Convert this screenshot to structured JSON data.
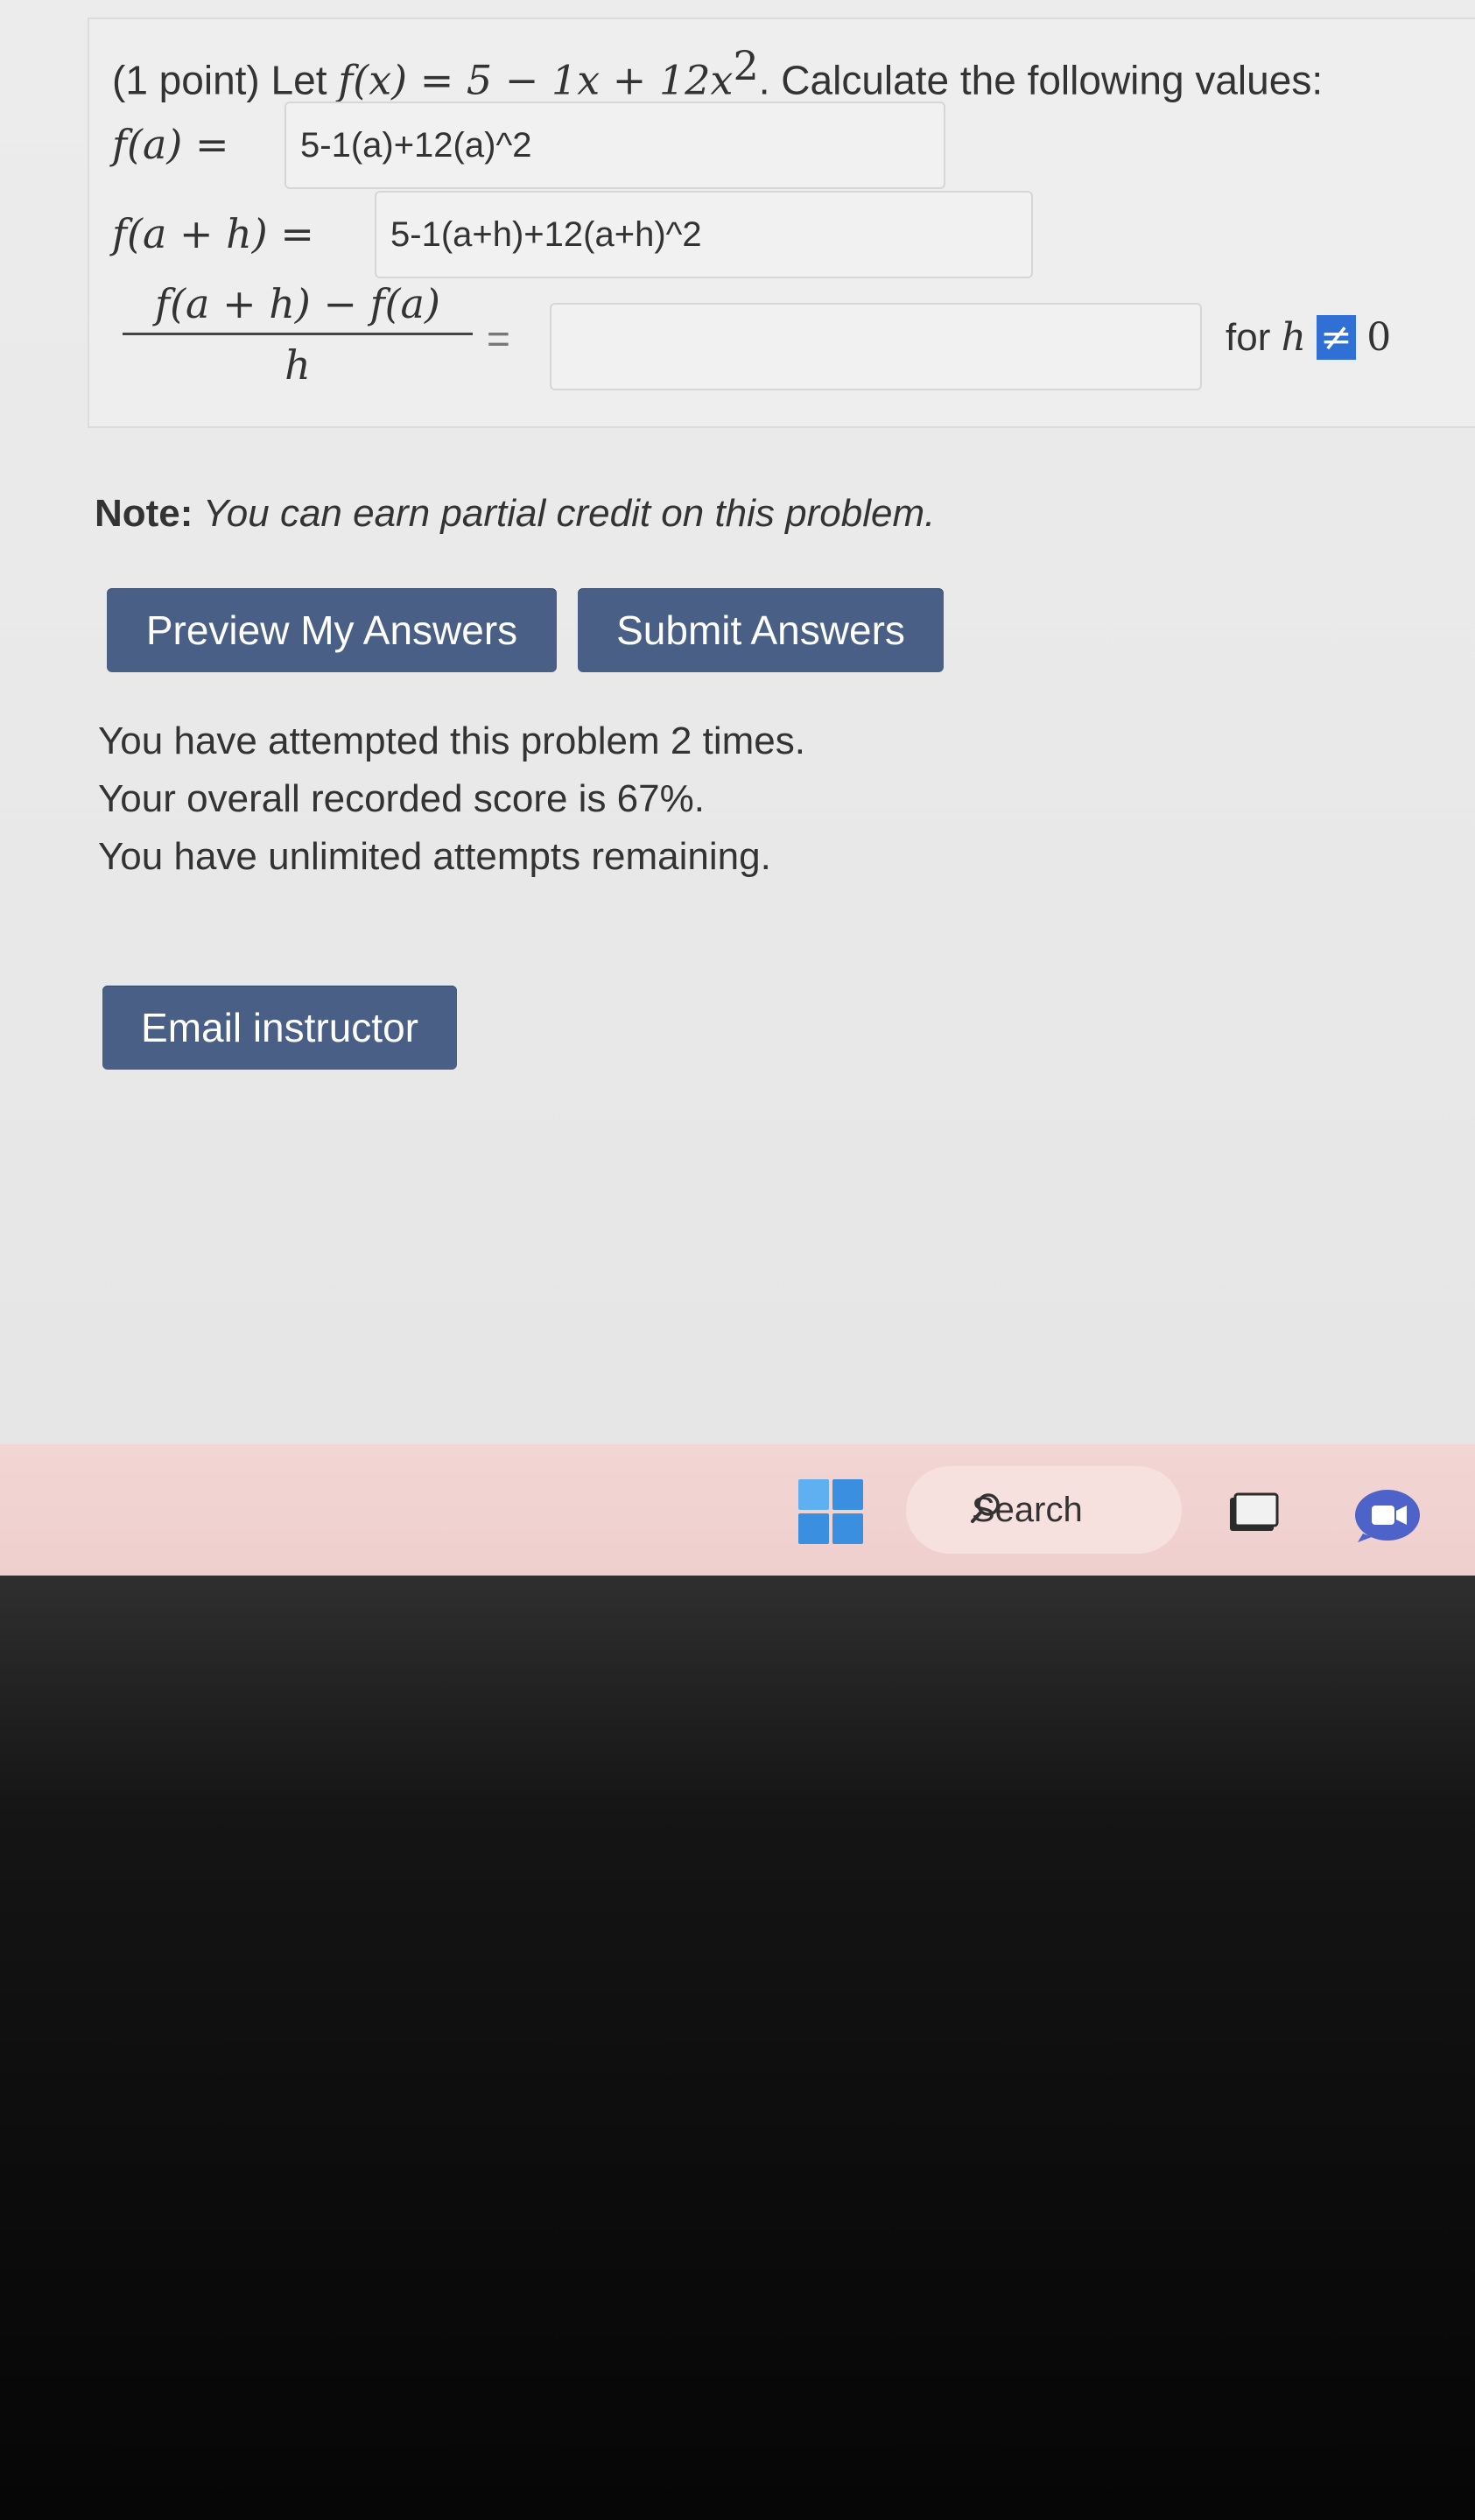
{
  "problem": {
    "intro_prefix": "(1 point) Let ",
    "function_def": "f(x) = 5 − 1x + 12x",
    "function_exp": "2",
    "intro_suffix": ". Calculate the following values:",
    "row1": {
      "label": "f(a) =",
      "value": "5-1(a)+12(a)^2"
    },
    "row2": {
      "label": "f(a + h) =",
      "value": "5-1(a+h)+12(a+h)^2"
    },
    "row3": {
      "numerator": "f(a + h) − f(a)",
      "denominator": "h",
      "equals": "=",
      "value": "",
      "condition_prefix": "for ",
      "condition_var": "h",
      "condition_neq": "≠",
      "condition_value": "0"
    }
  },
  "note": {
    "label": "Note:",
    "text": " You can earn partial credit on this problem."
  },
  "buttons": {
    "preview": "Preview My Answers",
    "submit": "Submit Answers",
    "email": "Email instructor"
  },
  "status": {
    "attempts": "You have attempted this problem 2 times.",
    "score": "Your overall recorded score is 67%.",
    "remaining": "You have unlimited attempts remaining."
  },
  "taskbar": {
    "search_label": "Search",
    "icons": [
      "windows-start-icon",
      "search-icon",
      "task-view-icon",
      "meet-chat-icon"
    ]
  },
  "colors": {
    "button_bg": "#4a5f86",
    "button_text": "#ffffff",
    "accent_highlight": "#2f6fd6",
    "taskbar_bg": "#f2d6d4"
  }
}
